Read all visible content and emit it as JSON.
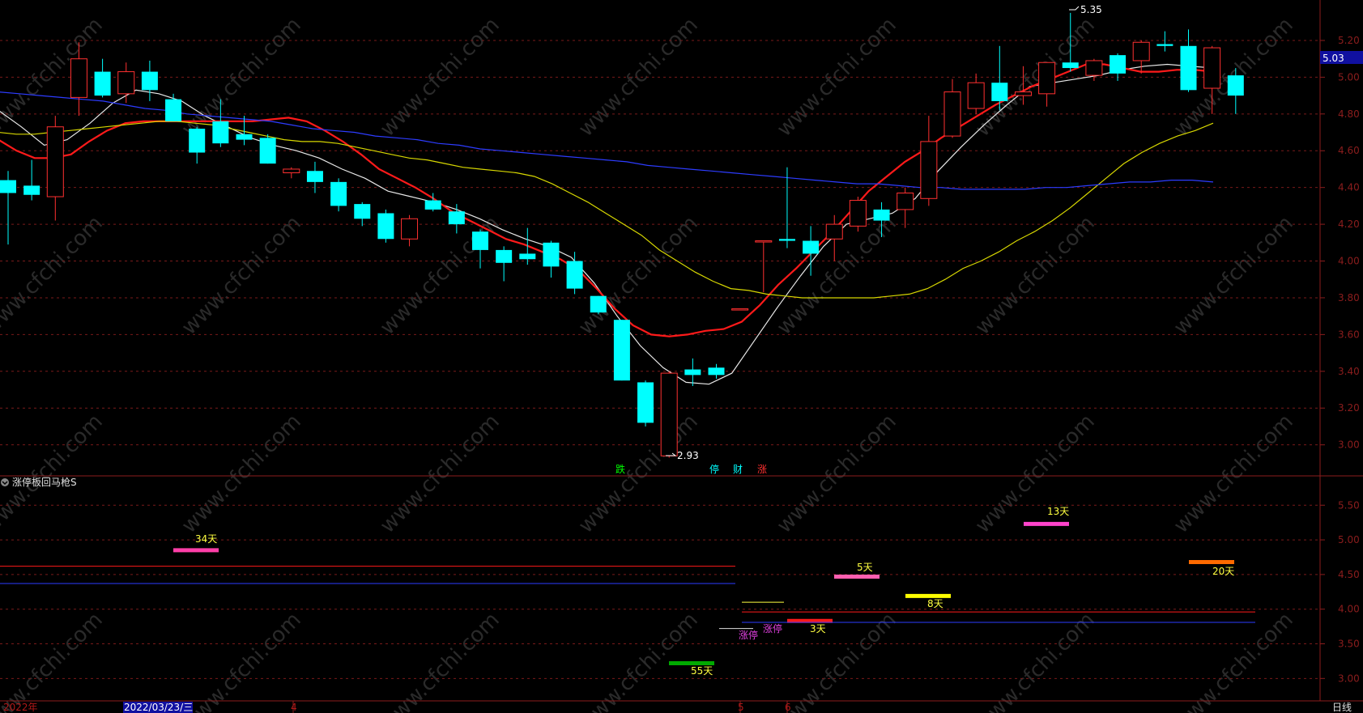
{
  "colors": {
    "background": "#000000",
    "grid": "#7a1a1a",
    "axis": "#8b1d1d",
    "up": "#ff3030",
    "down": "#00ffff",
    "ma5": "#e8e8e8",
    "ma10": "#ff1a1a",
    "ma20": "#d7d700",
    "ma60": "#2d3cff",
    "label_yellow": "#ffff40",
    "price_box": "#1010a0"
  },
  "watermark": "www.cfchi.com",
  "main_axis": {
    "ticks": [
      "5.20",
      "5.00",
      "4.80",
      "4.60",
      "4.40",
      "4.20",
      "4.00",
      "3.80",
      "3.60",
      "3.40",
      "3.20",
      "3.00"
    ],
    "ylim": [
      2.84,
      5.42
    ],
    "current_price": "5.03"
  },
  "annotations": {
    "high_label": "5.35",
    "low_label": "2.93",
    "markers": [
      {
        "text": "跌",
        "color": "#00ff00"
      },
      {
        "text": "停",
        "color": "#00ffff"
      },
      {
        "text": "财",
        "color": "#00ffff"
      },
      {
        "text": "涨",
        "color": "#ff3030"
      }
    ]
  },
  "indicator": {
    "name": "涨停板回马枪S",
    "ticks": [
      "5.50",
      "5.00",
      "4.50",
      "4.00",
      "3.50",
      "3.00"
    ],
    "ylim": [
      2.7,
      5.9
    ],
    "labels": [
      "34天",
      "55天",
      "涨停",
      "涨停",
      "3天",
      "5天",
      "8天",
      "13天",
      "20天"
    ]
  },
  "date_axis": {
    "year_label": "2022年",
    "cursor_date": "2022/03/23/三",
    "month_labels": [
      "4",
      "5",
      "6"
    ],
    "period_label": "日线"
  },
  "chart_data": {
    "type": "candlestick",
    "series": [
      {
        "type": "candle",
        "values": [
          {
            "o": 4.44,
            "h": 4.49,
            "l": 4.09,
            "c": 4.37
          },
          {
            "o": 4.41,
            "h": 4.55,
            "l": 4.33,
            "c": 4.36
          },
          {
            "o": 4.35,
            "h": 4.79,
            "l": 4.22,
            "c": 4.73
          },
          {
            "o": 4.89,
            "h": 5.19,
            "l": 4.79,
            "c": 5.1
          },
          {
            "o": 5.03,
            "h": 5.1,
            "l": 4.89,
            "c": 4.9
          },
          {
            "o": 4.91,
            "h": 5.08,
            "l": 4.86,
            "c": 5.03
          },
          {
            "o": 5.03,
            "h": 5.09,
            "l": 4.87,
            "c": 4.93
          },
          {
            "o": 4.88,
            "h": 4.91,
            "l": 4.77,
            "c": 4.76
          },
          {
            "o": 4.72,
            "h": 4.73,
            "l": 4.53,
            "c": 4.59
          },
          {
            "o": 4.76,
            "h": 4.88,
            "l": 4.62,
            "c": 4.64
          },
          {
            "o": 4.69,
            "h": 4.79,
            "l": 4.63,
            "c": 4.66
          },
          {
            "o": 4.67,
            "h": 4.69,
            "l": 4.53,
            "c": 4.53
          },
          {
            "o": 4.48,
            "h": 4.51,
            "l": 4.45,
            "c": 4.5
          },
          {
            "o": 4.49,
            "h": 4.54,
            "l": 4.37,
            "c": 4.43
          },
          {
            "o": 4.43,
            "h": 4.45,
            "l": 4.27,
            "c": 4.3
          },
          {
            "o": 4.31,
            "h": 4.32,
            "l": 4.19,
            "c": 4.23
          },
          {
            "o": 4.26,
            "h": 4.28,
            "l": 4.1,
            "c": 4.12
          },
          {
            "o": 4.12,
            "h": 4.25,
            "l": 4.08,
            "c": 4.23
          },
          {
            "o": 4.33,
            "h": 4.37,
            "l": 4.27,
            "c": 4.28
          },
          {
            "o": 4.27,
            "h": 4.31,
            "l": 4.15,
            "c": 4.2
          },
          {
            "o": 4.16,
            "h": 4.17,
            "l": 3.96,
            "c": 4.06
          },
          {
            "o": 4.06,
            "h": 4.08,
            "l": 3.89,
            "c": 3.99
          },
          {
            "o": 4.04,
            "h": 4.18,
            "l": 3.98,
            "c": 4.01
          },
          {
            "o": 4.1,
            "h": 4.11,
            "l": 3.91,
            "c": 3.97
          },
          {
            "o": 4.0,
            "h": 4.05,
            "l": 3.82,
            "c": 3.85
          },
          {
            "o": 3.81,
            "h": 3.81,
            "l": 3.71,
            "c": 3.72
          },
          {
            "o": 3.68,
            "h": 3.68,
            "l": 3.35,
            "c": 3.35
          },
          {
            "o": 3.34,
            "h": 3.35,
            "l": 3.1,
            "c": 3.12
          },
          {
            "o": 2.94,
            "h": 3.4,
            "l": 2.93,
            "c": 3.39
          },
          {
            "o": 3.41,
            "h": 3.47,
            "l": 3.32,
            "c": 3.38
          },
          {
            "o": 3.42,
            "h": 3.44,
            "l": 3.36,
            "c": 3.38
          },
          {
            "o": 3.74,
            "h": 3.74,
            "l": 3.74,
            "c": 3.74
          },
          {
            "o": 4.11,
            "h": 4.11,
            "l": 3.83,
            "c": 4.11
          },
          {
            "o": 4.12,
            "h": 4.51,
            "l": 4.07,
            "c": 4.11
          },
          {
            "o": 4.11,
            "h": 4.19,
            "l": 3.92,
            "c": 4.04
          },
          {
            "o": 4.12,
            "h": 4.25,
            "l": 4.0,
            "c": 4.2
          },
          {
            "o": 4.19,
            "h": 4.35,
            "l": 4.16,
            "c": 4.33
          },
          {
            "o": 4.28,
            "h": 4.32,
            "l": 4.13,
            "c": 4.22
          },
          {
            "o": 4.28,
            "h": 4.4,
            "l": 4.18,
            "c": 4.37
          },
          {
            "o": 4.34,
            "h": 4.79,
            "l": 4.3,
            "c": 4.65
          },
          {
            "o": 4.68,
            "h": 4.99,
            "l": 4.67,
            "c": 4.92
          },
          {
            "o": 4.83,
            "h": 5.02,
            "l": 4.8,
            "c": 4.97
          },
          {
            "o": 4.97,
            "h": 5.17,
            "l": 4.82,
            "c": 4.87
          },
          {
            "o": 4.9,
            "h": 5.06,
            "l": 4.85,
            "c": 4.92
          },
          {
            "o": 4.91,
            "h": 5.07,
            "l": 4.84,
            "c": 5.08
          },
          {
            "o": 5.08,
            "h": 5.35,
            "l": 5.03,
            "c": 5.05
          },
          {
            "o": 5.01,
            "h": 5.1,
            "l": 4.98,
            "c": 5.09
          },
          {
            "o": 5.12,
            "h": 5.13,
            "l": 4.98,
            "c": 5.02
          },
          {
            "o": 5.09,
            "h": 5.2,
            "l": 5.02,
            "c": 5.19
          },
          {
            "o": 5.18,
            "h": 5.25,
            "l": 5.14,
            "c": 5.17
          },
          {
            "o": 5.17,
            "h": 5.26,
            "l": 4.92,
            "c": 4.93
          },
          {
            "o": 4.94,
            "h": 5.17,
            "l": 4.8,
            "c": 5.16
          },
          {
            "o": 5.01,
            "h": 5.05,
            "l": 4.8,
            "c": 4.9
          }
        ]
      },
      {
        "name": "MA5",
        "values": [
          4.82,
          4.73,
          4.63,
          4.66,
          4.75,
          4.86,
          4.93,
          4.91,
          4.87,
          4.79,
          4.73,
          4.67,
          4.63,
          4.6,
          4.56,
          4.5,
          4.45,
          4.38,
          4.35,
          4.32,
          4.28,
          4.23,
          4.17,
          4.12,
          4.08,
          4.02,
          3.88,
          3.7,
          3.54,
          3.42,
          3.34,
          3.33,
          3.39,
          3.57,
          3.75,
          3.92,
          4.08,
          4.2,
          4.23,
          4.26,
          4.34,
          4.49,
          4.62,
          4.74,
          4.85,
          4.95,
          4.97,
          4.99,
          5.01,
          5.04,
          5.06,
          5.07,
          5.06,
          5.05
        ]
      },
      {
        "name": "MA10",
        "values": [
          4.66,
          4.6,
          4.56,
          4.56,
          4.58,
          4.65,
          4.71,
          4.75,
          4.76,
          4.76,
          4.76,
          4.76,
          4.76,
          4.76,
          4.76,
          4.77,
          4.78,
          4.76,
          4.71,
          4.65,
          4.58,
          4.5,
          4.45,
          4.4,
          4.34,
          4.27,
          4.22,
          4.17,
          4.12,
          4.09,
          4.05,
          4.01,
          3.95,
          3.85,
          3.74,
          3.65,
          3.6,
          3.59,
          3.6,
          3.62,
          3.63,
          3.67,
          3.76,
          3.87,
          3.96,
          4.06,
          4.16,
          4.27,
          4.38,
          4.46,
          4.54,
          4.6,
          4.67,
          4.73,
          4.79,
          4.85,
          4.9,
          4.95,
          4.99,
          5.03,
          5.07,
          5.07,
          5.05,
          5.03,
          5.03,
          5.04,
          5.04,
          5.03
        ]
      },
      {
        "name": "MA20",
        "values": [
          4.7,
          4.69,
          4.69,
          4.7,
          4.71,
          4.72,
          4.73,
          4.74,
          4.75,
          4.76,
          4.76,
          4.75,
          4.74,
          4.72,
          4.7,
          4.68,
          4.66,
          4.65,
          4.65,
          4.64,
          4.62,
          4.6,
          4.58,
          4.56,
          4.55,
          4.53,
          4.51,
          4.5,
          4.49,
          4.48,
          4.46,
          4.42,
          4.37,
          4.32,
          4.26,
          4.2,
          4.14,
          4.06,
          4.0,
          3.94,
          3.89,
          3.85,
          3.84,
          3.82,
          3.81,
          3.8,
          3.8,
          3.8,
          3.8,
          3.8,
          3.81,
          3.82,
          3.85,
          3.9,
          3.96,
          4.0,
          4.05,
          4.11,
          4.16,
          4.22,
          4.29,
          4.37,
          4.45,
          4.53,
          4.59,
          4.64,
          4.68,
          4.71,
          4.75
        ]
      },
      {
        "name": "MA60",
        "values": [
          4.92,
          4.91,
          4.9,
          4.89,
          4.88,
          4.87,
          4.85,
          4.83,
          4.82,
          4.8,
          4.79,
          4.78,
          4.77,
          4.76,
          4.74,
          4.72,
          4.71,
          4.7,
          4.68,
          4.67,
          4.66,
          4.64,
          4.63,
          4.61,
          4.6,
          4.59,
          4.58,
          4.57,
          4.56,
          4.55,
          4.54,
          4.52,
          4.51,
          4.5,
          4.49,
          4.48,
          4.47,
          4.46,
          4.45,
          4.44,
          4.43,
          4.42,
          4.42,
          4.41,
          4.4,
          4.4,
          4.39,
          4.39,
          4.39,
          4.39,
          4.4,
          4.4,
          4.41,
          4.42,
          4.43,
          4.43,
          4.44,
          4.44,
          4.43
        ]
      }
    ],
    "indicator_lines": [
      {
        "name": "34天",
        "value": 4.85,
        "color": "#ff3fa8"
      },
      {
        "name": "55天",
        "value": 3.22,
        "color": "#00aa00"
      },
      {
        "name": "3天",
        "value": 3.83,
        "color": "#ff1a1a"
      },
      {
        "name": "5天",
        "value": 4.47,
        "color": "#ff5fb0"
      },
      {
        "name": "8天",
        "value": 4.19,
        "color": "#ffff00"
      },
      {
        "name": "13天",
        "value": 5.23,
        "color": "#ff44cc"
      },
      {
        "name": "20天",
        "value": 4.68,
        "color": "#ff6a00"
      },
      {
        "name": "hline-red-1",
        "value": 4.62,
        "color": "#ff1a1a"
      },
      {
        "name": "hline-blue-1",
        "value": 4.37,
        "color": "#2d3cff"
      },
      {
        "name": "hline-red-2",
        "value": 3.96,
        "color": "#ff1a1a"
      },
      {
        "name": "hline-blue-2",
        "value": 3.81,
        "color": "#2d3cff"
      }
    ]
  }
}
